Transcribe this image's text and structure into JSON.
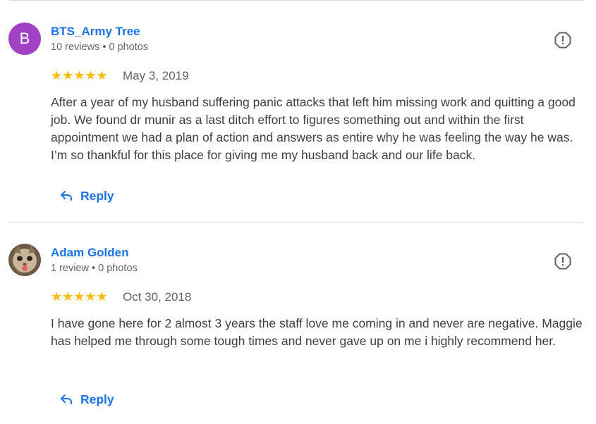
{
  "reviews": [
    {
      "avatar_letter": "B",
      "name": "BTS_Army Tree",
      "meta": "10 reviews • 0 photos",
      "rating": 5,
      "stars": "★★★★★",
      "date": "May 3, 2019",
      "text": "After a year of my husband suffering panic attacks that left him missing work and quitting a good job. We found dr munir as a last ditch effort to figures something out and within the first appointment we had a plan of action and answers as entire why he was feeling the way he was. I’m so thankful for this place for giving me my husband back and our life back.",
      "reply_label": "Reply"
    },
    {
      "avatar_letter": "",
      "name": "Adam Golden",
      "meta": "1 review • 0 photos",
      "rating": 5,
      "stars": "★★★★★",
      "date": "Oct 30, 2018",
      "text": "I have gone here for 2 almost 3 years the staff love me coming in and never are negative. Maggie has helped me through some tough times and never gave up on me i highly recommend her.",
      "reply_label": "Reply"
    }
  ],
  "colors": {
    "link": "#1a73e8",
    "star": "#fbbc04",
    "secondary_text": "#5f6368",
    "avatar_bg": "#a142c4",
    "divider": "#dadce0"
  },
  "icons": {
    "flag": "report-flag-icon",
    "reply": "reply-arrow-icon"
  }
}
